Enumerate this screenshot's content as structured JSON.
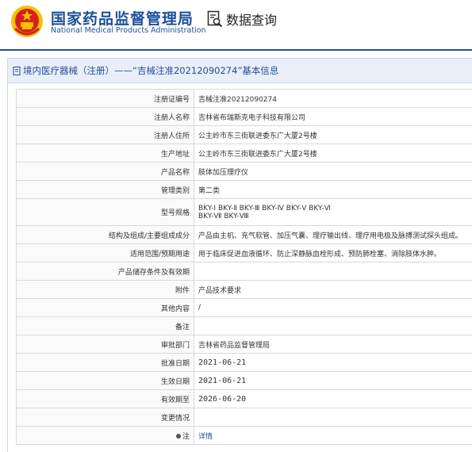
{
  "header": {
    "title": "国家药品监督管理局",
    "subtitle": "National Medical Products Administration",
    "query_label": "数据查询"
  },
  "panel": {
    "heading": "境内医疗器械（注册）——“吉械注准20212090274”基本信息"
  },
  "rows": [
    {
      "label": "注册证编号",
      "value": "吉械注准20212090274"
    },
    {
      "label": "注册人名称",
      "value": "吉林省布瑞斯克电子科技有限公司"
    },
    {
      "label": "注册人住所",
      "value": "公主岭市东三街联进委东广大厦2号楼"
    },
    {
      "label": "生产地址",
      "value": "公主岭市东三街联进委东广大厦2号楼"
    },
    {
      "label": "产品名称",
      "value": "肢体加压理疗仪"
    },
    {
      "label": "管理类别",
      "value": "第二类"
    },
    {
      "label": "型号规格",
      "value": "BKY-Ⅰ BKY-Ⅱ BKY-Ⅲ BKY-Ⅳ BKY-Ⅴ BKY-Ⅵ",
      "value2": "BKY-Ⅶ BKY-Ⅷ"
    },
    {
      "label": "结构及组成/主要组成成分",
      "value": "产品由主机、充气软管、加压气囊、理疗输出线、理疗用电极及脉搏测试探头组成。"
    },
    {
      "label": "适用范围/预期用途",
      "value": "用于临床促进血液循环、防止深静脉血栓形成、预防肺栓塞、消除肢体水肿。"
    },
    {
      "label": "产品储存条件及有效期",
      "value": ""
    },
    {
      "label": "附件",
      "value": "产品技术要求"
    },
    {
      "label": "其他内容",
      "value": "/"
    },
    {
      "label": "备注",
      "value": ""
    },
    {
      "label": "审批部门",
      "value": "吉林省药品监督管理局"
    },
    {
      "label": "批准日期",
      "value": "2021-06-21"
    },
    {
      "label": "生效日期",
      "value": "2021-06-21"
    },
    {
      "label": "有效期至",
      "value": "2026-06-20"
    },
    {
      "label": "变更情况",
      "value": ""
    },
    {
      "label": "注",
      "value": "详情"
    }
  ],
  "colors": {
    "brand_blue": "#1f4e9c",
    "emblem_red": "#d61f1f",
    "emblem_gold": "#f2c200"
  },
  "icons": {
    "emblem": "national-emblem-icon",
    "query": "search-document-icon",
    "heading": "document-icon",
    "note": "note-icon"
  }
}
